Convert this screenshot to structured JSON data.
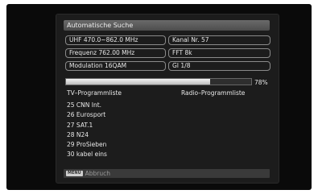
{
  "dialog": {
    "title": "Automatische Suche"
  },
  "params": {
    "band": "UHF  470.0~862.0 MHz",
    "channel": "Kanal Nr.  57",
    "frequency": "Frequenz  762.00 MHz",
    "fft": "FFT  8k",
    "modulation": "Modulation  16QAM",
    "gi": "GI  1/8"
  },
  "progress": {
    "value": 0.78,
    "label": "78%"
  },
  "lists": {
    "tv_header": "TV–Programmliste",
    "radio_header": "Radio–Programmliste",
    "tv_items": [
      "25  CNN Int.",
      "26  Eurosport",
      "27  SAT.1",
      "28  N24",
      "29  ProSieben",
      "30  kabel eins"
    ]
  },
  "footer": {
    "key_label": "MENU",
    "action_label": "Abbruch"
  }
}
